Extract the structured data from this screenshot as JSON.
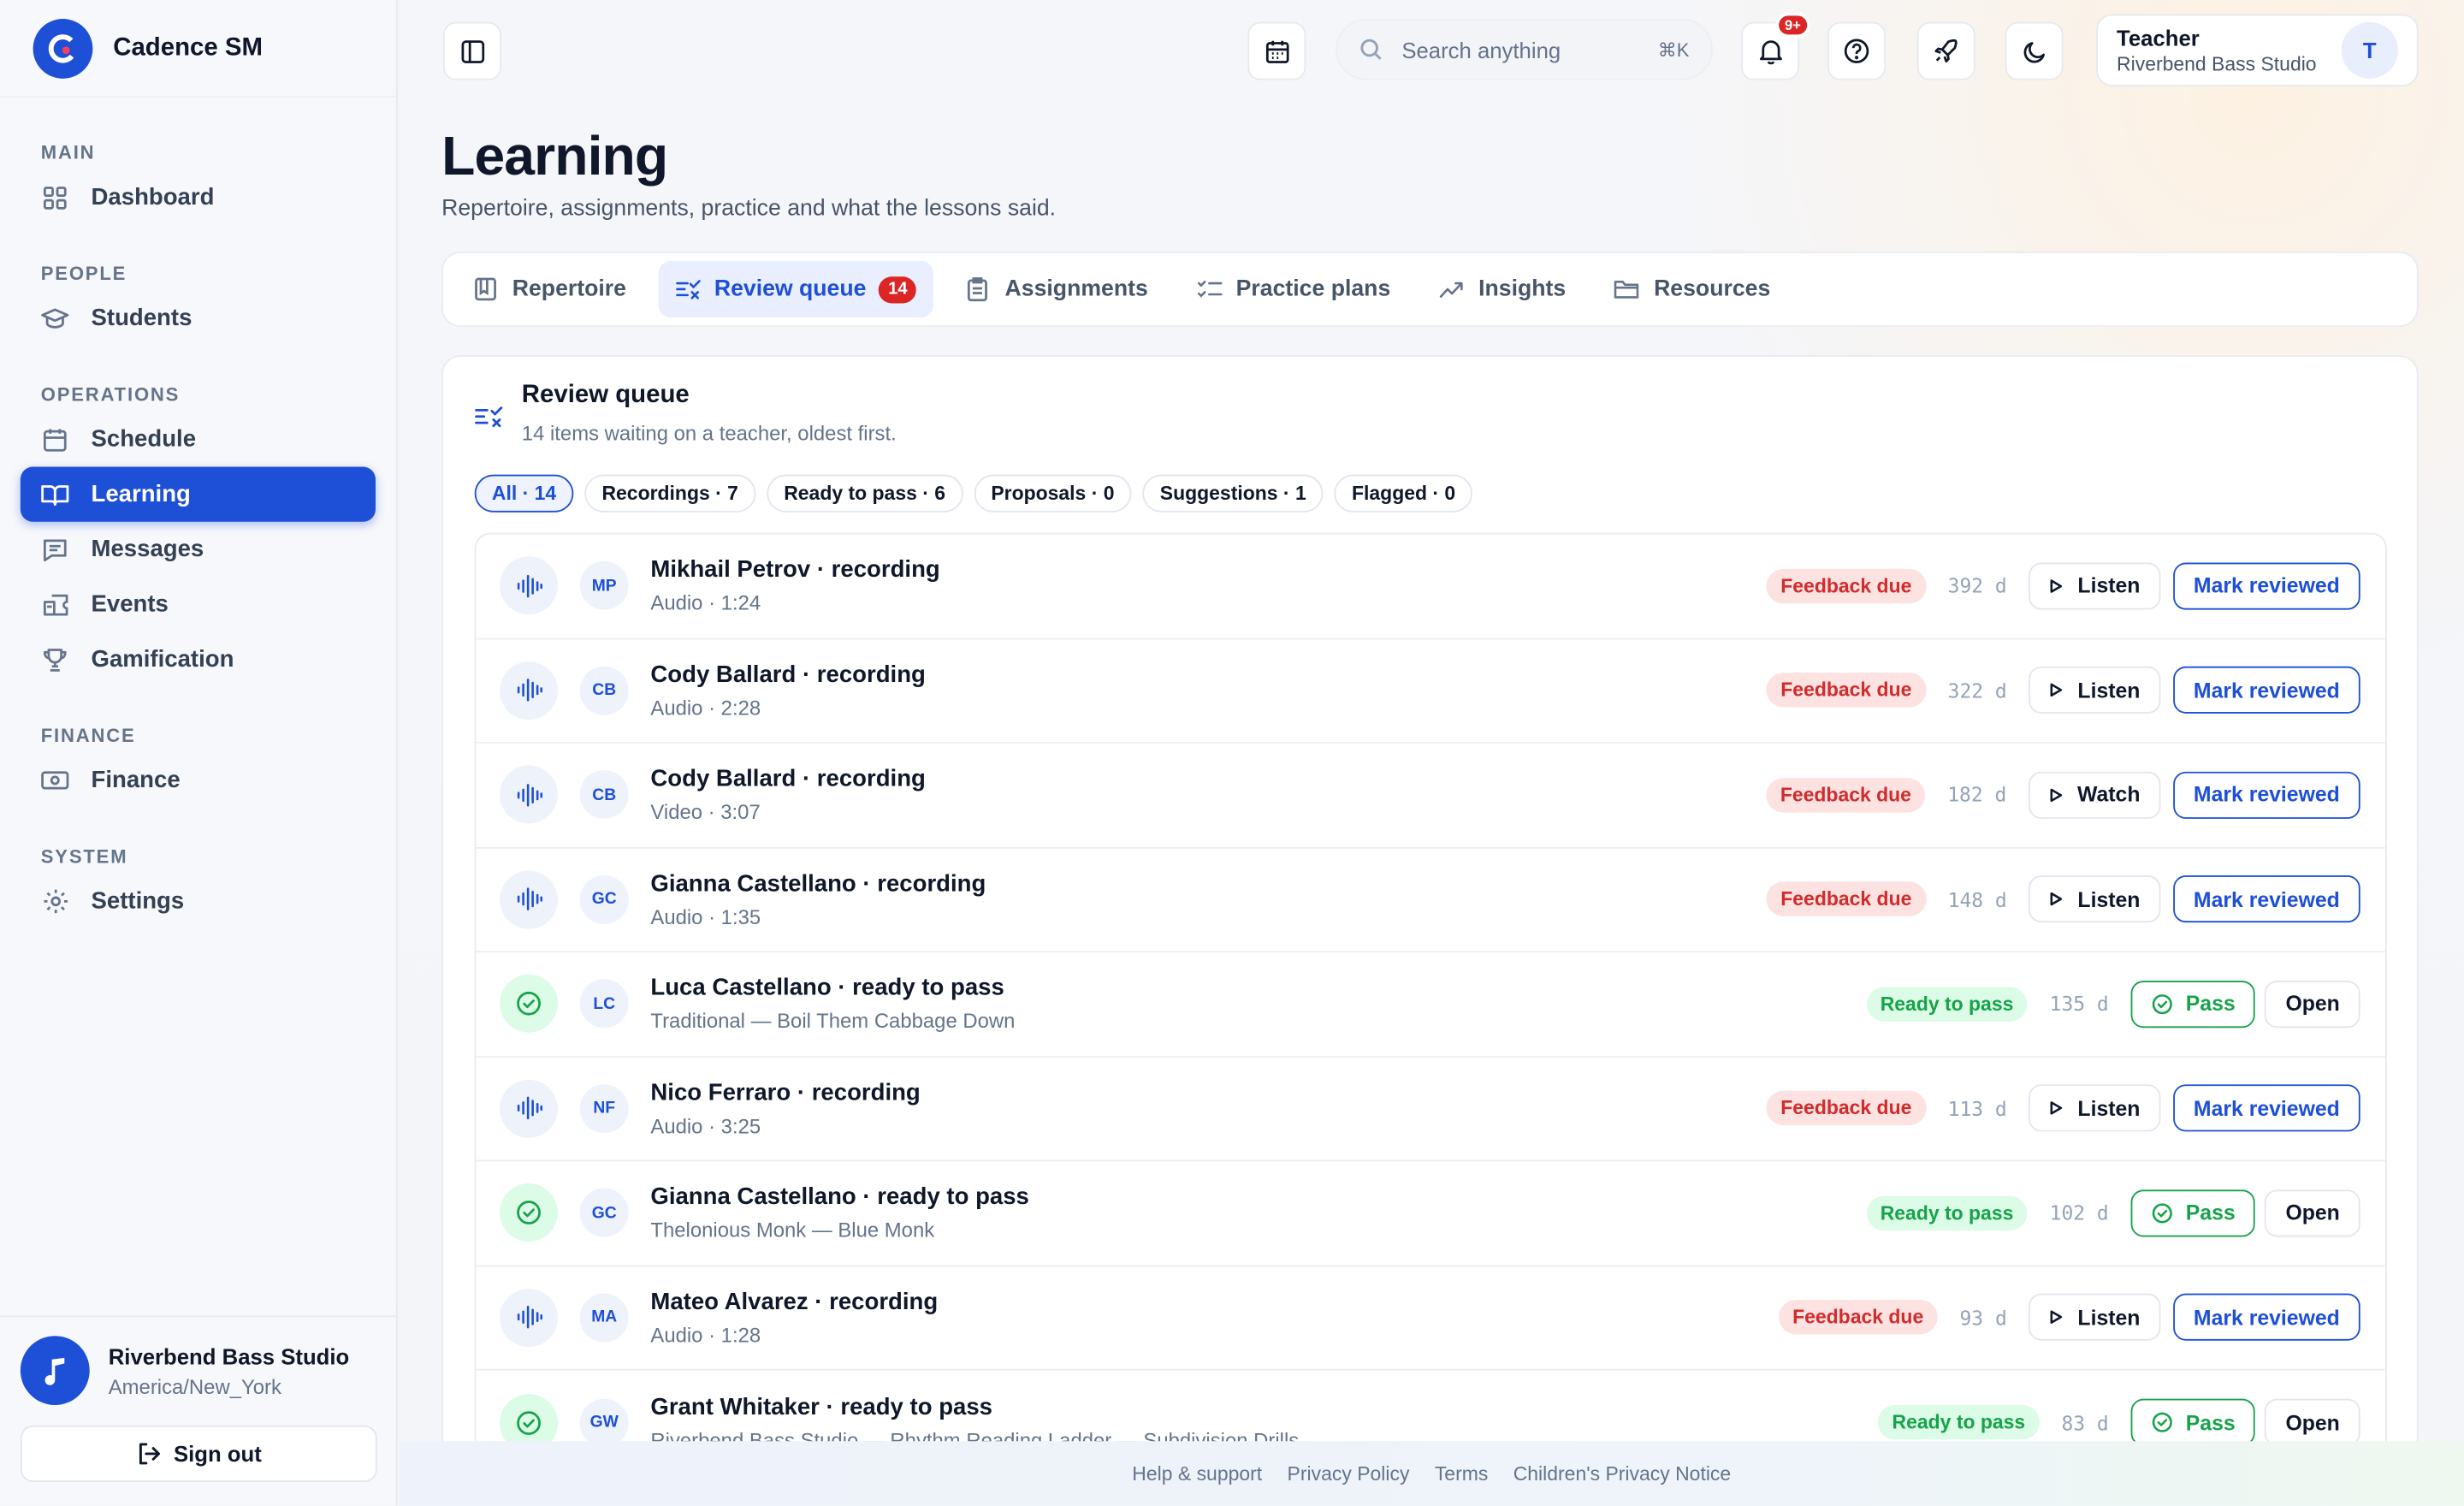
{
  "app": {
    "name": "Cadence SM"
  },
  "nav": {
    "sections": [
      {
        "title": "MAIN",
        "items": [
          {
            "label": "Dashboard",
            "icon": "grid-icon"
          }
        ]
      },
      {
        "title": "PEOPLE",
        "items": [
          {
            "label": "Students",
            "icon": "graduation-cap-icon"
          }
        ]
      },
      {
        "title": "OPERATIONS",
        "items": [
          {
            "label": "Schedule",
            "icon": "calendar-icon"
          },
          {
            "label": "Learning",
            "icon": "book-open-icon",
            "active": true
          },
          {
            "label": "Messages",
            "icon": "message-icon"
          },
          {
            "label": "Events",
            "icon": "ticket-icon"
          },
          {
            "label": "Gamification",
            "icon": "trophy-icon"
          }
        ]
      },
      {
        "title": "FINANCE",
        "items": [
          {
            "label": "Finance",
            "icon": "banknote-icon"
          }
        ]
      },
      {
        "title": "SYSTEM",
        "items": [
          {
            "label": "Settings",
            "icon": "gear-icon"
          }
        ]
      }
    ]
  },
  "studio": {
    "name": "Riverbend Bass Studio",
    "timezone": "America/New_York",
    "avatar_icon": "music-note-icon"
  },
  "signout": {
    "label": "Sign out"
  },
  "topbar": {
    "search_placeholder": "Search anything",
    "search_shortcut": "⌘K",
    "notifications_badge": "9+",
    "user_role": "Teacher",
    "user_studio": "Riverbend Bass Studio",
    "user_initial": "T"
  },
  "page": {
    "title": "Learning",
    "subtitle": "Repertoire, assignments, practice and what the lessons said."
  },
  "tabs": [
    {
      "label": "Repertoire",
      "icon": "repertoire-icon"
    },
    {
      "label": "Review queue",
      "icon": "review-queue-icon",
      "count": "14",
      "active": true
    },
    {
      "label": "Assignments",
      "icon": "clipboard-icon"
    },
    {
      "label": "Practice plans",
      "icon": "checklist-icon"
    },
    {
      "label": "Insights",
      "icon": "trend-icon"
    },
    {
      "label": "Resources",
      "icon": "folder-icon"
    }
  ],
  "queue": {
    "title": "Review queue",
    "subtitle": "14 items waiting on a teacher, oldest first.",
    "filters": [
      {
        "label": "All · 14",
        "active": true
      },
      {
        "label": "Recordings · 7"
      },
      {
        "label": "Ready to pass · 6"
      },
      {
        "label": "Proposals · 0"
      },
      {
        "label": "Suggestions · 1"
      },
      {
        "label": "Flagged · 0"
      }
    ],
    "items": [
      {
        "kind": "recording",
        "initials": "MP",
        "title": "Mikhail Petrov · recording",
        "detail": "Audio · 1:24",
        "status": "Feedback due",
        "age": "392 d",
        "action": "Listen",
        "secondary": "Mark reviewed"
      },
      {
        "kind": "recording",
        "initials": "CB",
        "title": "Cody Ballard · recording",
        "detail": "Audio · 2:28",
        "status": "Feedback due",
        "age": "322 d",
        "action": "Listen",
        "secondary": "Mark reviewed"
      },
      {
        "kind": "recording",
        "initials": "CB",
        "title": "Cody Ballard · recording",
        "detail": "Video · 3:07",
        "status": "Feedback due",
        "age": "182 d",
        "action": "Watch",
        "secondary": "Mark reviewed"
      },
      {
        "kind": "recording",
        "initials": "GC",
        "title": "Gianna Castellano · recording",
        "detail": "Audio · 1:35",
        "status": "Feedback due",
        "age": "148 d",
        "action": "Listen",
        "secondary": "Mark reviewed"
      },
      {
        "kind": "pass",
        "initials": "LC",
        "title": "Luca Castellano · ready to pass",
        "detail": "Traditional — Boil Them Cabbage Down",
        "status": "Ready to pass",
        "age": "135 d",
        "action": "Pass",
        "secondary": "Open"
      },
      {
        "kind": "recording",
        "initials": "NF",
        "title": "Nico Ferraro · recording",
        "detail": "Audio · 3:25",
        "status": "Feedback due",
        "age": "113 d",
        "action": "Listen",
        "secondary": "Mark reviewed"
      },
      {
        "kind": "pass",
        "initials": "GC",
        "title": "Gianna Castellano · ready to pass",
        "detail": "Thelonious Monk — Blue Monk",
        "status": "Ready to pass",
        "age": "102 d",
        "action": "Pass",
        "secondary": "Open"
      },
      {
        "kind": "recording",
        "initials": "MA",
        "title": "Mateo Alvarez · recording",
        "detail": "Audio · 1:28",
        "status": "Feedback due",
        "age": "93 d",
        "action": "Listen",
        "secondary": "Mark reviewed"
      },
      {
        "kind": "pass",
        "initials": "GW",
        "title": "Grant Whitaker · ready to pass",
        "detail": "Riverbend Bass Studio — Rhythm Reading Ladder — Subdivision Drills",
        "status": "Ready to pass",
        "age": "83 d",
        "action": "Pass",
        "secondary": "Open"
      }
    ]
  },
  "footer": {
    "links": [
      "Help & support",
      "Privacy Policy",
      "Terms",
      "Children's Privacy Notice"
    ]
  },
  "colors": {
    "accent": "#1d4fd7",
    "danger": "#dc2626",
    "success": "#16a34a"
  }
}
